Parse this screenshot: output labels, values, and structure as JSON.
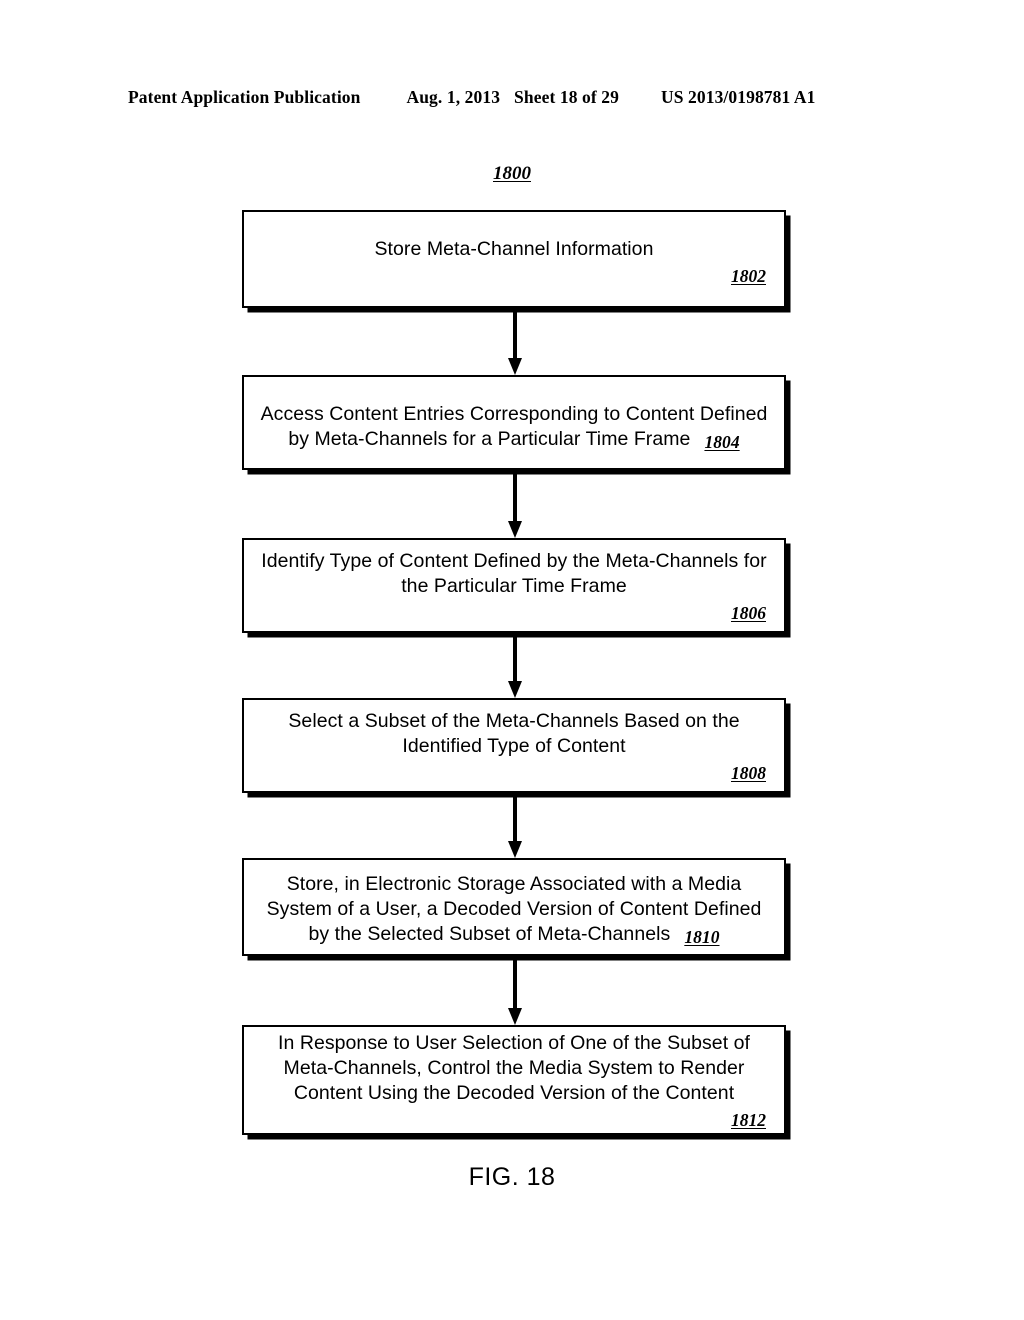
{
  "header": {
    "publication": "Patent Application Publication",
    "date": "Aug. 1, 2013",
    "sheet": "Sheet 18 of 29",
    "patent_number": "US 2013/0198781 A1"
  },
  "figure": {
    "figure_ref": "1800",
    "caption": "FIG. 18",
    "steps": [
      {
        "ref": "1802",
        "ref_placement": "line",
        "lines": [
          "Store Meta-Channel Information"
        ]
      },
      {
        "ref": "1804",
        "ref_placement": "inline",
        "lines": [
          "Access Content Entries Corresponding to Content Defined",
          "by Meta-Channels for a Particular Time Frame"
        ]
      },
      {
        "ref": "1806",
        "ref_placement": "line",
        "lines": [
          "Identify Type of Content Defined by the Meta-Channels for",
          "the Particular Time Frame"
        ]
      },
      {
        "ref": "1808",
        "ref_placement": "line",
        "lines": [
          "Select a Subset of the Meta-Channels Based on the",
          "Identified Type of Content"
        ]
      },
      {
        "ref": "1810",
        "ref_placement": "inline",
        "lines": [
          "Store, in Electronic Storage Associated with a Media",
          "System of a User, a Decoded Version of Content Defined",
          "by the Selected Subset of Meta-Channels"
        ]
      },
      {
        "ref": "1812",
        "ref_placement": "line",
        "lines": [
          "In Response to User Selection of One of the Subset of",
          "Meta-Channels, Control the Media System to Render",
          "Content Using the Decoded Version of the Content"
        ]
      }
    ],
    "connectors": [
      {
        "from": "1802",
        "to": "1804",
        "type": "arrow-down"
      },
      {
        "from": "1804",
        "to": "1806",
        "type": "arrow-down"
      },
      {
        "from": "1806",
        "to": "1808",
        "type": "arrow-down"
      },
      {
        "from": "1808",
        "to": "1810",
        "type": "arrow-down"
      },
      {
        "from": "1810",
        "to": "1812",
        "type": "arrow-down"
      }
    ]
  },
  "colors": {
    "ink": "#000000",
    "paper": "#ffffff"
  }
}
